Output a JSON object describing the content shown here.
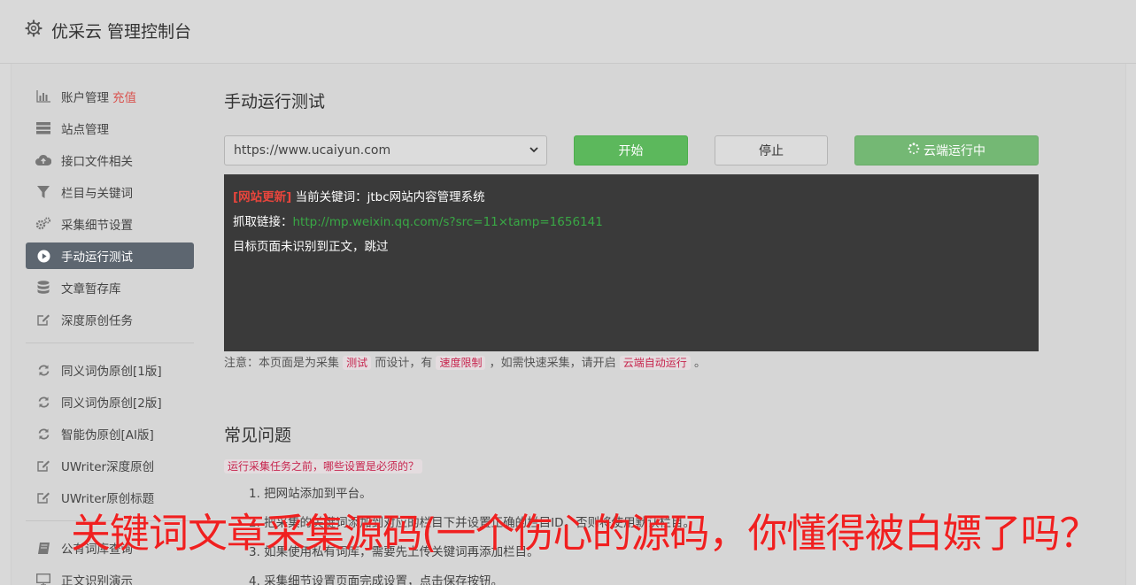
{
  "header": {
    "title": "优采云 管理控制台",
    "icon": "gear-icon"
  },
  "sidebar": {
    "group1": [
      {
        "label": "账户管理",
        "extra": "充值",
        "icon": "bar-chart-icon"
      },
      {
        "label": "站点管理",
        "icon": "server-icon"
      },
      {
        "label": "接口文件相关",
        "icon": "cloud-upload-icon"
      },
      {
        "label": "栏目与关键词",
        "icon": "filter-icon"
      },
      {
        "label": "采集细节设置",
        "icon": "cogs-icon"
      },
      {
        "label": "手动运行测试",
        "icon": "play-circle-icon",
        "active": true
      },
      {
        "label": "文章暂存库",
        "icon": "database-icon"
      },
      {
        "label": "深度原创任务",
        "icon": "edit-icon"
      }
    ],
    "group2": [
      {
        "label": "同义词伪原创[1版]",
        "icon": "refresh-icon"
      },
      {
        "label": "同义词伪原创[2版]",
        "icon": "refresh-icon"
      },
      {
        "label": "智能伪原创[AI版]",
        "icon": "refresh-icon"
      },
      {
        "label": "UWriter深度原创",
        "icon": "edit-icon"
      },
      {
        "label": "UWriter原创标题",
        "icon": "edit-icon"
      }
    ],
    "group3": [
      {
        "label": "公有词库查询",
        "icon": "book-icon"
      },
      {
        "label": "正文识别演示",
        "icon": "monitor-icon"
      }
    ]
  },
  "main": {
    "title": "手动运行测试",
    "site_select": {
      "value": "https://www.ucaiyun.com"
    },
    "buttons": {
      "start": "开始",
      "stop": "停止",
      "cloud": "云端运行中"
    },
    "console": {
      "line1_tag": "[网站更新]",
      "line1_text": " 当前关键词：jtbc网站内容管理系统",
      "line2_label": "抓取链接：",
      "line2_link": "http://mp.weixin.qq.com/s?src=11×tamp=1656141",
      "line3": "目标页面未识别到正文，跳过"
    },
    "note": {
      "part1": "注意：本页面是为采集",
      "code1": "测试",
      "part2": "而设计，有",
      "code2": "速度限制",
      "part3": "，如需快速采集，请开启",
      "code3": "云端自动运行",
      "part4": "。"
    },
    "faq": {
      "title": "常见问题",
      "question": "运行采集任务之前，哪些设置是必须的？",
      "items": [
        "1. 把网站添加到平台。",
        "2. 把采集的关键词添加到对应的栏目下并设置正确的栏目ID，否则将使用默认栏目。",
        "3. 如果使用私有词库，需要先上传关键词再添加栏目。",
        "4. 采集细节设置页面完成设置，点击保存按钮。"
      ]
    }
  },
  "overlay": {
    "text": "关键词文章采集源码(一个伤心的源码，你懂得被白嫖了吗？"
  },
  "colors": {
    "active_nav": "#5d6670",
    "start_btn": "#5cb85c",
    "console_bg": "#3a3a3a",
    "overlay": "#f02020"
  }
}
